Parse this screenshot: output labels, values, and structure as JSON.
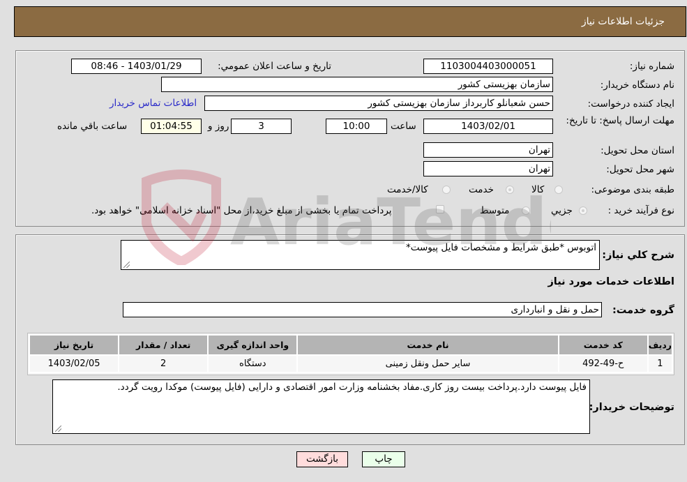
{
  "header": {
    "title": "جزئيات اطلاعات نياز"
  },
  "form": {
    "need_number": {
      "label": "شماره نياز:",
      "value": "1103004403000051"
    },
    "announce": {
      "label": "تاريخ و ساعت اعلان عمومي:",
      "value": "1403/01/29 - 08:46"
    },
    "buyer_org": {
      "label": "نام دستگاه خريدار:",
      "value": "سازمان بهزيستی کشور"
    },
    "creator": {
      "label": "ايجاد کننده درخواست:",
      "value": "حسن  شعبانلو کاربرداز سازمان بهزيستی کشور"
    },
    "contact_link": "اطلاعات تماس خريدار",
    "deadline": {
      "label": "مهلت ارسال پاسخ: تا تاريخ:",
      "date": "1403/02/01",
      "time_label": "ساعت",
      "time": "10:00",
      "days": "3",
      "days_label": "روز و",
      "remaining": "01:04:55",
      "remaining_label": "ساعت باقي مانده"
    },
    "province": {
      "label": "استان محل تحويل:",
      "value": "تهران"
    },
    "city": {
      "label": "شهر محل تحويل:",
      "value": "تهران"
    },
    "category": {
      "label": "طبقه بندی موضوعی:",
      "options": [
        "کالا",
        "خدمت",
        "کالا/خدمت"
      ],
      "selected": "خدمت"
    },
    "process": {
      "label": "نوع فرآيند خريد :",
      "options": [
        "جزيي",
        "متوسط"
      ],
      "selected": "جزيي",
      "treasury_note": "پرداخت تمام يا بخشی از مبلغ خريد،از محل \"اسناد خزانه اسلامی\" خواهد بود."
    }
  },
  "details": {
    "summary_label": "شرح کلي نياز:",
    "summary_value": "اتوبوس *طبق شرايط و مشخصات فايل پيوست*",
    "services_title": "اطلاعات خدمات مورد نياز",
    "service_group_label": "گروه خدمت:",
    "service_group_value": "حمل و نقل و انبارداری",
    "table": {
      "headers": [
        "رديف",
        "کد خدمت",
        "نام خدمت",
        "واحد اندازه گيری",
        "تعداد / مقدار",
        "تاريخ نياز"
      ],
      "rows": [
        [
          "1",
          "ح-49-492",
          "ساير حمل ونقل زمينی",
          "دستگاه",
          "2",
          "1403/02/05"
        ]
      ]
    },
    "buyer_notes_label": "توضيحات خريدار:",
    "buyer_notes_value": "فايل پيوست دارد.پرداخت بيست روز کاری.مفاد بخشنامه وزارت امور اقتصادی و دارايی (فايل پيوست) موکدا رويت گردد."
  },
  "buttons": {
    "print": "چاپ",
    "back": "بازگشت"
  },
  "colors": {
    "header_bg": "#8b6b42",
    "link": "#2929c8",
    "back_bg": "#ffdcdc",
    "print_bg": "#eaffea",
    "remaining_bg": "#ffffe8"
  },
  "watermark": {
    "text": "AriaTender.neT"
  }
}
